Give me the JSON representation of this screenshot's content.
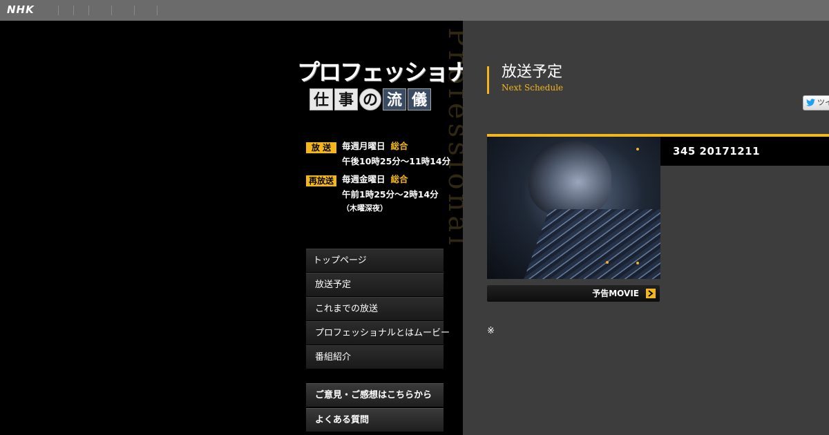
{
  "topbar": {
    "logo": "NHK",
    "separator_count": 6
  },
  "program": {
    "logo_main": "プロフェッショナル",
    "logo_sub": [
      "仕",
      "事",
      "の",
      "流",
      "儀"
    ],
    "bg_script": "Professional"
  },
  "schedule": {
    "broadcast": {
      "badge": "放 送",
      "line1": "毎週月曜日",
      "channel": "総合",
      "line2": "午後10時25分～11時14分"
    },
    "rebroadcast": {
      "badge": "再放送",
      "line1": "毎週金曜日",
      "channel": "総合",
      "line2": "午前1時25分～2時14分",
      "note": "（木曜深夜）"
    }
  },
  "nav": {
    "items": [
      {
        "label": "トップページ"
      },
      {
        "label": "放送予定"
      },
      {
        "label": "これまでの放送"
      },
      {
        "label": "プロフェッショナルとはムービー"
      },
      {
        "label": "番組紹介"
      }
    ]
  },
  "nav2": {
    "items": [
      {
        "label": "ご意見・ご感想はこちらから"
      },
      {
        "label": "よくある質問"
      }
    ]
  },
  "main": {
    "heading_jp": "放送予定",
    "heading_en": "Next Schedule",
    "tweet_label": "ツイ",
    "episode_title": "345 20171211",
    "movie_button": "予告MOVIE",
    "note_mark": "※"
  },
  "colors": {
    "accent": "#f3b71c",
    "topbar": "#6b6b6b",
    "right_panel": "#3d3d3d"
  }
}
